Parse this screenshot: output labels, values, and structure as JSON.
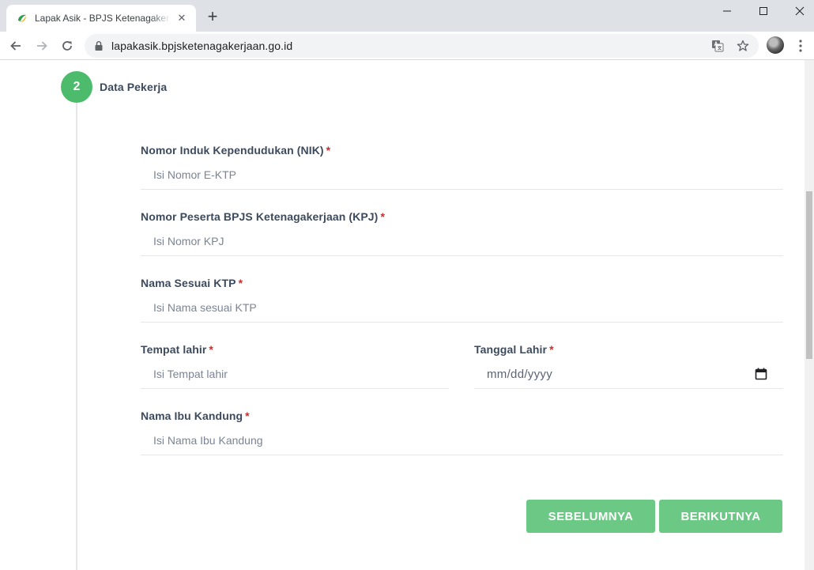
{
  "browser": {
    "tab_title": "Lapak Asik - BPJS Ketenagakerjaan",
    "url": "lapakasik.bpjsketenagakerjaan.go.id"
  },
  "step": {
    "number": "2",
    "title": "Data Pekerja"
  },
  "form": {
    "nik": {
      "label": "Nomor Induk Kependudukan (NIK)",
      "required": "*",
      "placeholder": "Isi Nomor E-KTP",
      "value": ""
    },
    "kpj": {
      "label": "Nomor Peserta BPJS Ketenagakerjaan (KPJ)",
      "required": "*",
      "placeholder": "Isi Nomor KPJ",
      "value": ""
    },
    "nama": {
      "label": "Nama Sesuai KTP",
      "required": "*",
      "placeholder": "Isi Nama sesuai KTP",
      "value": ""
    },
    "tempat_lahir": {
      "label": "Tempat lahir",
      "required": "*",
      "placeholder": "Isi Tempat lahir",
      "value": ""
    },
    "tanggal_lahir": {
      "label": "Tanggal Lahir",
      "required": "*",
      "placeholder": "mm/dd/yyyy"
    },
    "ibu_kandung": {
      "label": "Nama Ibu Kandung",
      "required": "*",
      "placeholder": "Isi Nama Ibu Kandung",
      "value": ""
    }
  },
  "buttons": {
    "prev": "SEBELUMNYA",
    "next": "BERIKUTNYA"
  },
  "colors": {
    "accent": "#4cbb6c",
    "button": "#6cc985",
    "required": "#e02424"
  }
}
